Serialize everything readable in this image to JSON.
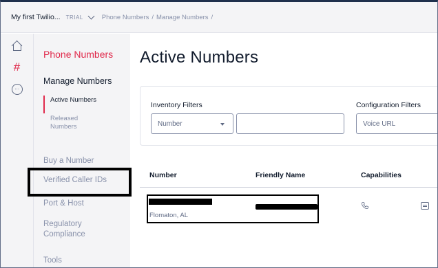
{
  "topbar": {
    "account_name": "My first Twilio...",
    "account_badge": "TRIAL",
    "breadcrumb": [
      "Phone Numbers",
      "Manage Numbers"
    ],
    "breadcrumb_sep": "/"
  },
  "rail": {
    "icons": [
      "home-icon",
      "hash-icon",
      "more-dots-icon"
    ],
    "active_color": "#e0284a"
  },
  "sidebar": {
    "title": "Phone Numbers",
    "section": "Manage Numbers",
    "sub_items": [
      "Active Numbers",
      "Released Numbers"
    ],
    "items": [
      "Buy a Number",
      "Verified Caller IDs",
      "Port & Host",
      "Regulatory Compliance",
      "Tools"
    ]
  },
  "main": {
    "title": "Active Numbers",
    "filters": {
      "inventory_label": "Inventory Filters",
      "inventory_select": "Number",
      "config_label": "Configuration Filters",
      "config_value": "Voice URL"
    },
    "table": {
      "headers": [
        "Number",
        "Friendly Name",
        "Capabilities"
      ],
      "rows": [
        {
          "location": "Flomaton, AL"
        }
      ]
    }
  },
  "colors": {
    "brand_red": "#e0284a",
    "nav_bg": "#f4f4f6",
    "text_muted": "#8891aa"
  }
}
